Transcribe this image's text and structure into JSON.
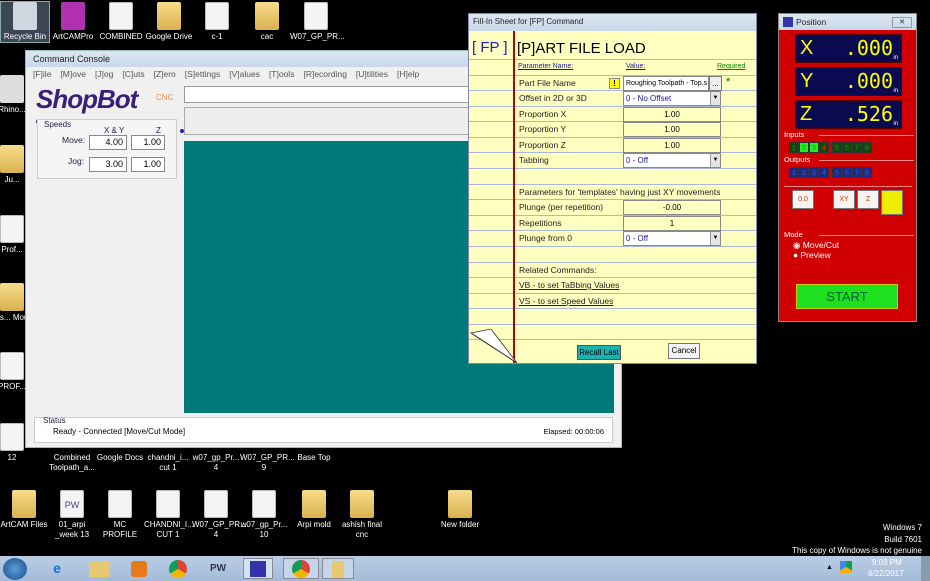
{
  "desktop": {
    "top_icons": [
      "Recycle Bin",
      "ArtCAMPro",
      "COMBINED",
      "Google Drive",
      "c-1",
      "cac",
      "W07_GP_PR..."
    ],
    "left_icons": [
      "Rhino...",
      "Ju...",
      "Prof...",
      "Avis... Mou...",
      "PROF...",
      "12"
    ],
    "mid_icons": [
      "Combined Toolpath_a...",
      "Google Docs",
      "chandni_i... cut 1",
      "w07_gp_Pr... 4",
      "W07_GP_PR... 9",
      "Base Top"
    ],
    "bottom_icons": [
      "ArtCAM Files",
      "01_arpi _week 13",
      "MC PROFILE",
      "CHANDNI_I... CUT 1",
      "W07_GP_PR... 4",
      "w07_gp_Pr... 10",
      "Arpi mold",
      "ashish final cnc",
      "New folder"
    ],
    "watermark": [
      "Windows 7",
      "Build 7601",
      "This copy of Windows is not genuine"
    ]
  },
  "console": {
    "title": "Command Console",
    "menu": [
      "[F]ile",
      "[M]ove",
      "[J]og",
      "[C]uts",
      "[Z]ero",
      "[S]ettings",
      "[V]alues",
      "[T]ools",
      "[R]ecording",
      "[U]tilities",
      "[H]elp"
    ],
    "logo": "ShopBot",
    "logo_sub": "CNC",
    "speeds": {
      "title": "Speeds",
      "col_xy": "X & Y",
      "col_z": "Z",
      "move_label": "Move:",
      "jog_label": "Jog:",
      "move_xy": "4.00",
      "move_z": "1.00",
      "jog_xy": "3.00",
      "jog_z": "1.00"
    },
    "status": {
      "title": "Status",
      "text": "Ready - Connected  [Move/Cut Mode]",
      "elapsed": "Elapsed: 00:00:06"
    }
  },
  "fill": {
    "title": "Fill-In Sheet for [FP] Command",
    "code": "[ FP  ]",
    "heading": "[P]ART FILE LOAD",
    "hdr_name": "Parameter Name:",
    "hdr_value": "Value:",
    "hdr_required": "Required",
    "part_file_label": "Part File Name",
    "part_file_value": "Roughing Toolpath - Top.s",
    "browse": "...",
    "warn": "!",
    "star": "*",
    "offset_label": "Offset in 2D or 3D",
    "offset_value": "0 - No Offset",
    "px_label": "Proportion X",
    "px": "1.00",
    "py_label": "Proportion Y",
    "py": "1.00",
    "pz_label": "Proportion Z",
    "pz": "1.00",
    "tab_label": "Tabbing",
    "tab_value": "0 - Off",
    "templates_note": "Parameters for 'templates' having just XY movements",
    "plunge_label": "Plunge (per repetition)",
    "plunge": "-0.00",
    "reps_label": "Repetitions",
    "reps": "1",
    "pf0_label": "Plunge from 0",
    "pf0_value": "0 - Off",
    "related": "Related Commands:",
    "link_vb": "VB - to set TaBbing Values",
    "link_vs": "VS - to set Speed Values",
    "recall": "Recall Last",
    "cancel": "Cancel"
  },
  "position": {
    "title": "Position",
    "axes": [
      {
        "name": "X",
        "value": ".000",
        "unit": "in"
      },
      {
        "name": "Y",
        "value": ".000",
        "unit": "in"
      },
      {
        "name": "Z",
        "value": ".526",
        "unit": "in"
      }
    ],
    "inputs_label": "Inputs",
    "inputs": [
      "1",
      "2",
      "3",
      "4",
      "5",
      "6",
      "7",
      "8"
    ],
    "inputs_active": [
      2,
      3
    ],
    "outputs_label": "Outputs",
    "outputs": [
      "1",
      "2",
      "3",
      "4",
      "5",
      "6",
      "7",
      "8"
    ],
    "mode_label": "Mode",
    "mode_options": [
      "Move/Cut",
      "Preview"
    ],
    "mode_selected": "Move/Cut",
    "start": "START",
    "tool_buttons": [
      "zero-0,0",
      "zero-xy",
      "zero-z",
      "keypad"
    ]
  },
  "taskbar": {
    "apps": [
      "start",
      "internet-explorer",
      "file-explorer",
      "media-player",
      "chrome",
      "PW",
      "shopbot",
      "chrome-user",
      "folder"
    ],
    "time": "9:03 PM",
    "date": "6/22/2017"
  },
  "colors": {
    "desktop": "#000000",
    "teal": "#007a78",
    "sheet": "#ffffc0",
    "position_bg": "#d00000",
    "start": "#1ee01e"
  }
}
